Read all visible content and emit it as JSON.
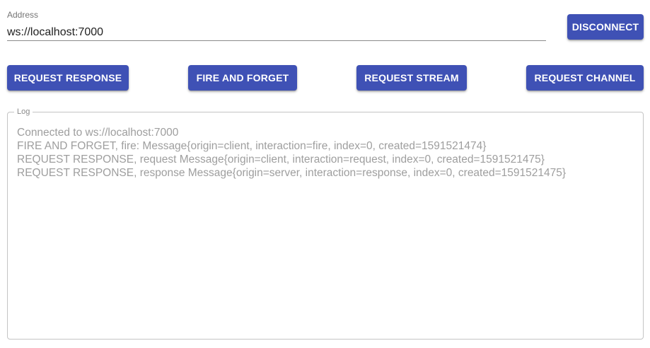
{
  "address": {
    "label": "Address",
    "value": "ws://localhost:7000"
  },
  "buttons": {
    "disconnect": "DISCONNECT",
    "request_response": "REQUEST RESPONSE",
    "fire_and_forget": "FIRE AND FORGET",
    "request_stream": "REQUEST STREAM",
    "request_channel": "REQUEST CHANNEL"
  },
  "log": {
    "label": "Log",
    "lines": [
      "Connected to ws://localhost:7000",
      "FIRE AND FORGET, fire: Message{origin=client, interaction=fire, index=0, created=1591521474}",
      "REQUEST RESPONSE, request Message{origin=client, interaction=request, index=0, created=1591521475}",
      "REQUEST RESPONSE, response Message{origin=server, interaction=response, index=0, created=1591521475}"
    ]
  },
  "colors": {
    "primary": "#3f51b5",
    "log_text": "#9e9e9e"
  }
}
